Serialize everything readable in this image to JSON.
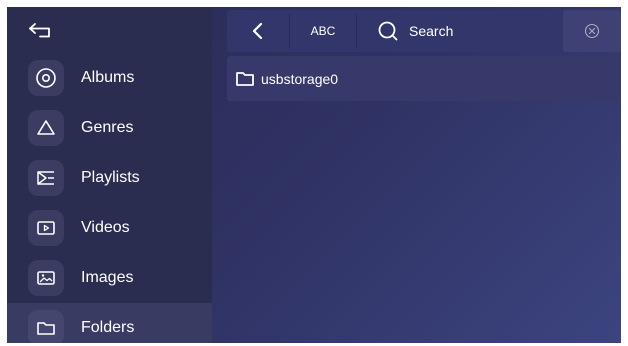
{
  "sidebar": {
    "items": [
      {
        "label": "Albums",
        "icon": "album-icon"
      },
      {
        "label": "Genres",
        "icon": "genres-icon"
      },
      {
        "label": "Playlists",
        "icon": "playlist-icon"
      },
      {
        "label": "Videos",
        "icon": "video-icon"
      },
      {
        "label": "Images",
        "icon": "image-icon"
      },
      {
        "label": "Folders",
        "icon": "folder-icon",
        "active": true
      }
    ]
  },
  "toolbar": {
    "abc_label": "ABC",
    "search_label": "Search"
  },
  "content": {
    "folders": [
      {
        "name": "usbstorage0"
      }
    ]
  },
  "colors": {
    "sidebar_bg": "#2b2d50",
    "active_item_bg": "#393b63",
    "toolbar_bg": "#33366a",
    "content_bg": "#2f3263"
  }
}
